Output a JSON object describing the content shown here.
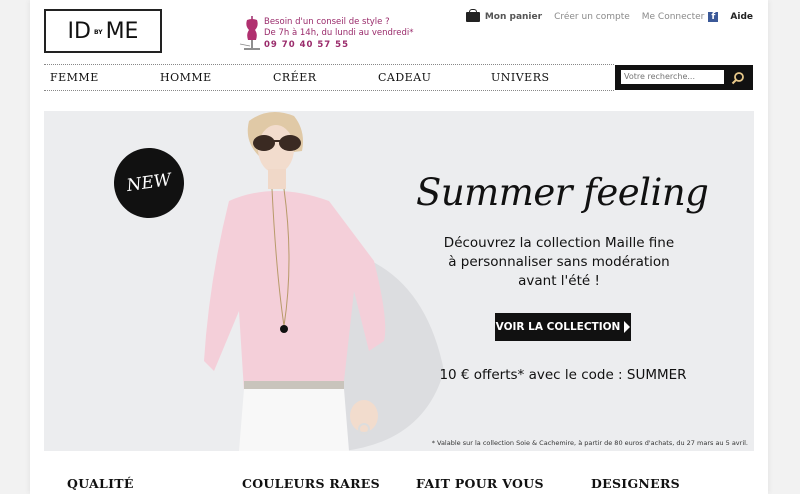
{
  "header": {
    "logo": {
      "text_left": "ID",
      "text_middle": "BY",
      "text_right": "ME"
    },
    "helpline": {
      "line1": "Besoin d'un conseil de style ?",
      "line2": "De 7h à 14h, du lundi au vendredi*",
      "phone": "09 70 40 57 55"
    },
    "toplinks": {
      "cart": "Mon panier",
      "create_account": "Créer un compte",
      "login": "Me Connecter",
      "facebook_glyph": "f",
      "help": "Aide"
    }
  },
  "nav": {
    "items": [
      "FEMME",
      "HOMME",
      "CRÉER",
      "CADEAU",
      "UNIVERS"
    ]
  },
  "search": {
    "placeholder": "Votre recherche..."
  },
  "hero": {
    "badge": "NEW",
    "title": "Summer feeling",
    "description_line1": "Découvrez la collection Maille fine",
    "description_line2": "à personnaliser sans modération",
    "description_line3": "avant l'été !",
    "cta": "VOIR LA COLLECTION",
    "offer": "10 € offerts* avec le code : SUMMER",
    "fine_print": "* Valable sur la collection Soie & Cachemire, à partir de 80 euros d'achats, du 27 mars au 5 avril."
  },
  "features": [
    "QUALITÉ",
    "COULEURS RARES",
    "FAIT POUR VOUS",
    "DESIGNERS"
  ],
  "colors": {
    "accent": "#9a2b6b",
    "dark": "#111111",
    "hero_bg": "#ecedef",
    "facebook": "#3b5998"
  },
  "icons": {
    "cart": "shopping-bag-icon",
    "helpline": "dress-form-icon",
    "search": "magnifier-icon",
    "facebook": "facebook-icon"
  }
}
